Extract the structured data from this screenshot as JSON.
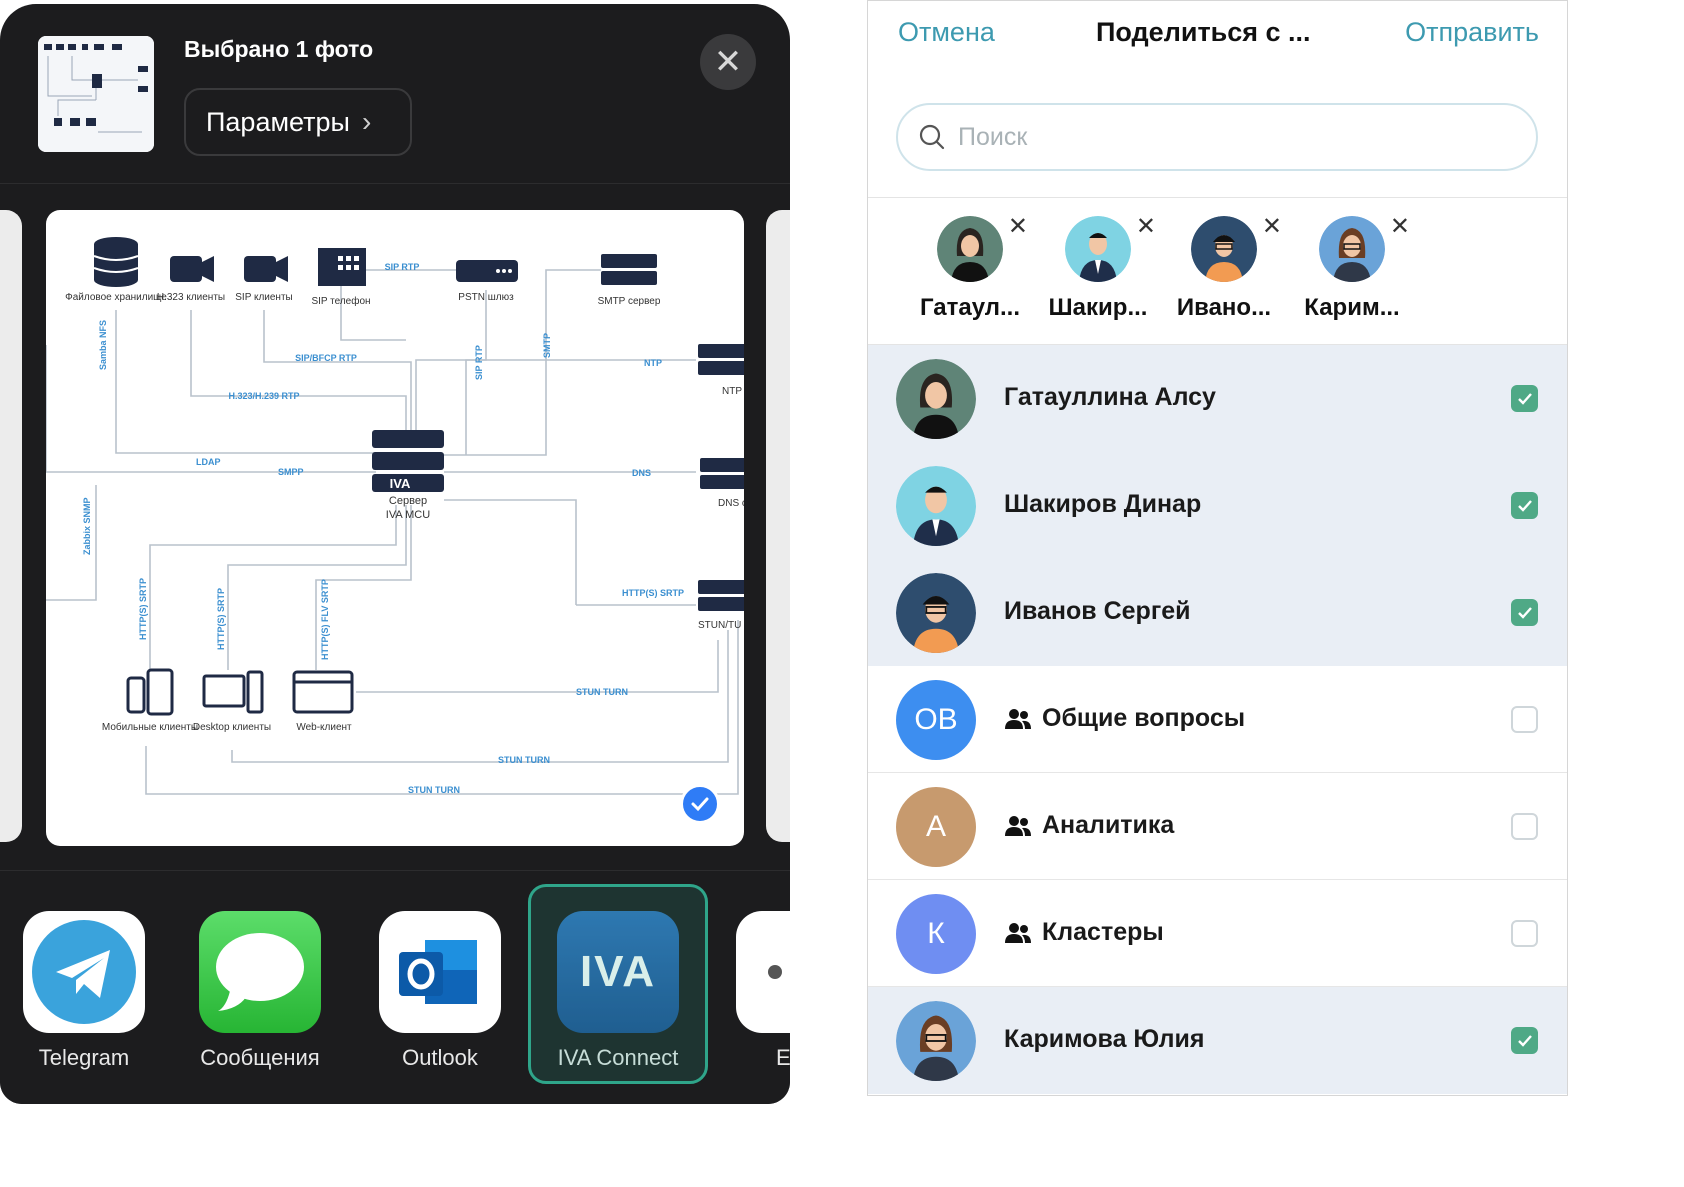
{
  "share_sheet": {
    "selection_title": "Выбрано 1 фото",
    "params_label": "Параметры",
    "diagram": {
      "nodes": {
        "file_storage": "Файловое хранилище",
        "h323": "H.323 клиенты",
        "sip_clients": "SIP клиенты",
        "sip_phone": "SIP телефон",
        "pstn": "PSTN шлюз",
        "smtp": "SMTP сервер",
        "ntp": "NTP серве",
        "dns": "DNS серве",
        "stun": "STUN/TU серве",
        "server_line1": "Сервер",
        "server_line2": "IVA MCU",
        "iva_badge": "IVA",
        "mobile": "Мобильные клиенты",
        "desktop": "Desktop клиенты",
        "web": "Web-клиент"
      },
      "links": {
        "sip_rtp": "SIP RTP",
        "samba": "Samba NFS",
        "sip_bfcp": "SIP/BFCP RTP",
        "h323_h239": "H.323/H.239 RTP",
        "sip_rtp_v": "SIP RTP",
        "smtp": "SMTP",
        "ntp": "NTP",
        "ldap": "LDAP",
        "smpp": "SMPP",
        "dns": "DNS",
        "zabbix": "Zabbix SNMP",
        "http_srtp_1": "HTTP(S) SRTP",
        "http_srtp_2": "HTTP(S) SRTP",
        "http_flv": "HTTP(S) FLV SRTP",
        "http_srtp_right": "HTTP(S) SRTP",
        "stun1": "STUN TURN",
        "stun2": "STUN TURN",
        "stun3": "STUN TURN"
      }
    },
    "apps": [
      {
        "label": "Telegram"
      },
      {
        "label": "Сообщения"
      },
      {
        "label": "Outlook"
      },
      {
        "label": "IVA Connect",
        "glyph": "IVA"
      },
      {
        "label": "E"
      }
    ],
    "colors": {
      "highlight": "#2fa58a",
      "sheet_bg": "#1c1c1e"
    }
  },
  "share_panel": {
    "cancel": "Отмена",
    "title": "Поделиться с ...",
    "send": "Отправить",
    "search_placeholder": "Поиск",
    "chips": [
      {
        "name": "Гатаул..."
      },
      {
        "name": "Шакир..."
      },
      {
        "name": "Ивано..."
      },
      {
        "name": "Карим..."
      }
    ],
    "contacts": [
      {
        "name": "Гатауллина Алсу",
        "checked": true
      },
      {
        "name": "Шакиров Динар",
        "checked": true
      },
      {
        "name": "Иванов Сергей",
        "checked": true
      },
      {
        "name": "Общие вопросы",
        "initials": "ОВ",
        "group": true,
        "checked": false
      },
      {
        "name": "Аналитика",
        "initials": "А",
        "group": true,
        "checked": false
      },
      {
        "name": "Кластеры",
        "initials": "К",
        "group": true,
        "checked": false
      },
      {
        "name": "Каримова Юлия",
        "checked": true
      }
    ],
    "colors": {
      "accent": "#3d9ab0",
      "checkbox_on": "#4fa986",
      "selected_row": "#e9eef5"
    }
  }
}
